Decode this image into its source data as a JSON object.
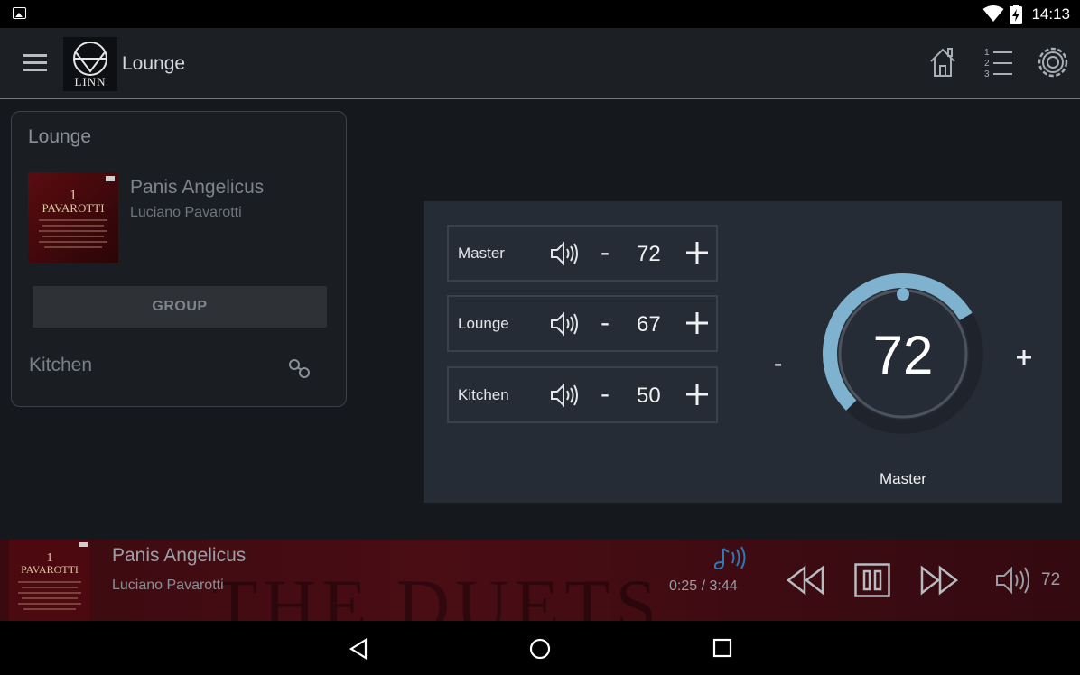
{
  "status_bar": {
    "time": "14:13",
    "icons": [
      "image-icon",
      "wifi-icon",
      "battery-charging-icon"
    ]
  },
  "app_bar": {
    "menu_icon": "menu-icon",
    "logo_text": "LINN",
    "title": "Lounge",
    "actions": [
      "home-icon",
      "playlist-icon",
      "settings-icon"
    ]
  },
  "room_card": {
    "title": "Lounge",
    "track": "Panis Angelicus",
    "artist": "Luciano Pavarotti",
    "group_button": "GROUP",
    "other_room": "Kitchen"
  },
  "volume_panel": {
    "rows": [
      {
        "label": "Master",
        "minus": "-",
        "value": "72"
      },
      {
        "label": "Lounge",
        "minus": "-",
        "value": "67"
      },
      {
        "label": "Kitchen",
        "minus": "-",
        "value": "50"
      }
    ],
    "dial": {
      "value": "72",
      "label": "Master",
      "minus": "-",
      "level": 0.72
    }
  },
  "now_playing": {
    "track": "Panis Angelicus",
    "artist": "Luciano Pavarotti",
    "time": "0:25 / 3:44",
    "volume": "72",
    "background_text": "THE DUETS"
  },
  "colors": {
    "accent": "#7fb2cf",
    "panel": "#262c35",
    "now_playing_bg": "#3e0b12"
  }
}
